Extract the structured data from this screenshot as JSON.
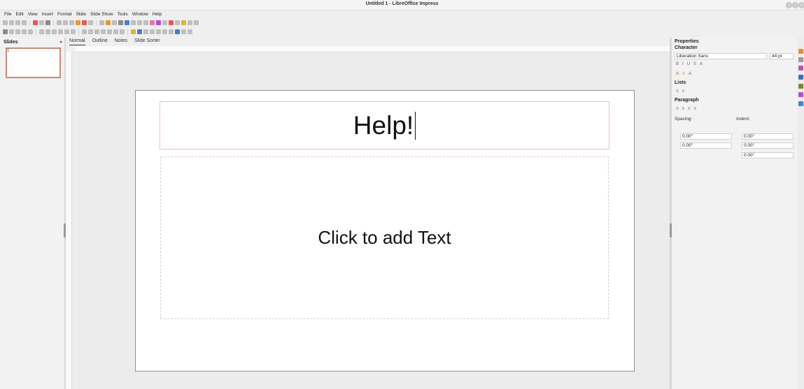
{
  "window": {
    "title": "Untitled 1 - LibreOffice Impress"
  },
  "menu": [
    "File",
    "Edit",
    "View",
    "Insert",
    "Format",
    "Slide",
    "Slide Show",
    "Tools",
    "Window",
    "Help"
  ],
  "slides_pane": {
    "title": "Slides",
    "slide_number": "1"
  },
  "view_tabs": [
    "Normal",
    "Outline",
    "Notes",
    "Slide Sorter"
  ],
  "slide": {
    "title_text": "Help!",
    "content_placeholder": "Click to add Text"
  },
  "properties": {
    "title": "Properties",
    "character": {
      "section": "Character",
      "font_name": "Liberation Sans",
      "font_size": "44 pt"
    },
    "lists": {
      "section": "Lists"
    },
    "paragraph": {
      "section": "Paragraph",
      "spacing_label": "Spacing:",
      "indent_label": "Indent:",
      "spacing_above": "0.00\"",
      "spacing_below": "0.00\"",
      "indent_before": "0.00\"",
      "indent_after": "0.00\"",
      "indent_first": "0.00\""
    }
  },
  "colors": {
    "accent_border": "#f0c2b8",
    "top_decoration": "#2f3fa8"
  }
}
